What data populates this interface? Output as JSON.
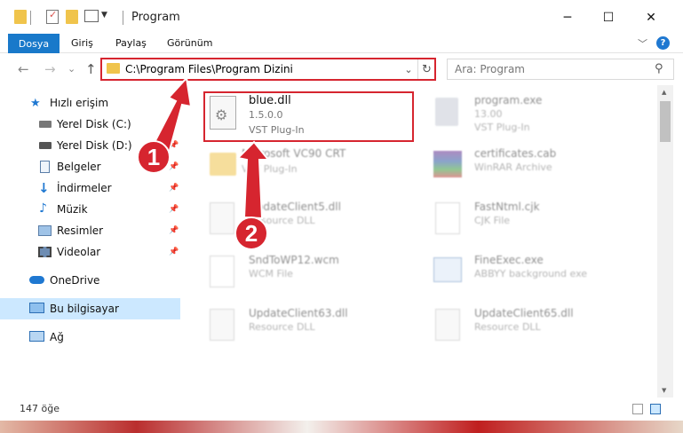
{
  "window": {
    "title": "Program",
    "minimize_glyph": "─",
    "maximize_glyph": "☐",
    "close_glyph": "✕"
  },
  "ribbon": {
    "tabs": [
      "Dosya",
      "Giriş",
      "Paylaş",
      "Görünüm"
    ],
    "expand_glyph": "﹀",
    "help_glyph": "?"
  },
  "nav": {
    "back_glyph": "←",
    "forward_glyph": "→",
    "recent_glyph": "⌄",
    "up_glyph": "↑"
  },
  "address": {
    "path": "C:\\Program Files\\Program Dizini",
    "dropdown_glyph": "⌄",
    "refresh_glyph": "↻"
  },
  "search": {
    "placeholder": "Ara: Program",
    "icon_glyph": "⚲"
  },
  "sidebar": {
    "items": [
      {
        "label": "Hızlı erişim",
        "icon": "star-icon"
      },
      {
        "label": "Yerel Disk (C:)",
        "icon": "drive-icon"
      },
      {
        "label": "Yerel Disk (D:)",
        "icon": "drive-icon"
      },
      {
        "label": "Belgeler",
        "icon": "documents-icon"
      },
      {
        "label": "İndirmeler",
        "icon": "download-icon"
      },
      {
        "label": "Müzik",
        "icon": "music-icon"
      },
      {
        "label": "Resimler",
        "icon": "pictures-icon"
      },
      {
        "label": "Videolar",
        "icon": "video-icon"
      },
      {
        "label": "OneDrive",
        "icon": "cloud-icon"
      },
      {
        "label": "Bu bilgisayar",
        "icon": "computer-icon"
      },
      {
        "label": "Ağ",
        "icon": "network-icon"
      }
    ],
    "pin_glyph": "📌"
  },
  "files": {
    "highlighted": {
      "name": "blue.dll",
      "version": "1.5.0.0",
      "type": "VST Plug-In"
    },
    "items": [
      {
        "name": "program.exe",
        "sub": "13.00",
        "type": "VST Plug-In"
      },
      {
        "name": "Microsoft VC90 CRT",
        "sub": "",
        "type": "VST Plug-In"
      },
      {
        "name": "certificates.cab",
        "sub": "WinRAR Archive",
        "type": ""
      },
      {
        "name": "UpdateClient5.dll",
        "sub": "Resource DLL",
        "type": ""
      },
      {
        "name": "FastNtml.cjk",
        "sub": "CJK File",
        "type": ""
      },
      {
        "name": "SndToWP12.wcm",
        "sub": "WCM File",
        "type": ""
      },
      {
        "name": "FineExec.exe",
        "sub": "ABBYY background exe",
        "type": ""
      },
      {
        "name": "UpdateClient63.dll",
        "sub": "Resource DLL",
        "type": ""
      },
      {
        "name": "UpdateClient65.dll",
        "sub": "Resource DLL",
        "type": ""
      }
    ]
  },
  "status": {
    "count": "147 öğe"
  },
  "annotations": {
    "step1": "1",
    "step2": "2"
  },
  "colors": {
    "accent": "#1979ca",
    "highlight_red": "#d6252f",
    "selected_nav": "#cce8ff"
  }
}
